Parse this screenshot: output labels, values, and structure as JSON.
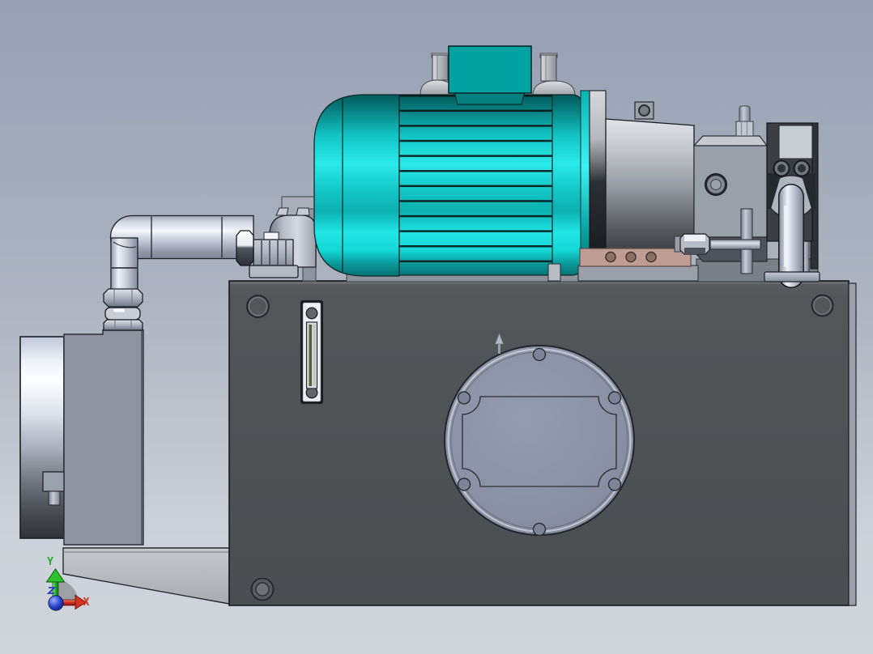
{
  "viewport": {
    "kind": "3d-cad-render",
    "subject": "hydraulic-power-unit-model",
    "triad": {
      "y_label": "Y",
      "x_label": "X",
      "y_color": "#1fae1f",
      "x_color": "#d03020",
      "z_color": "#2438c8",
      "origin_color": "#2a44cc"
    },
    "palette": {
      "background_top": "#96a0b2",
      "background_bottom": "#d0d4db",
      "motor_teal_bright": "#2beaea",
      "motor_teal_dark": "#035a5a",
      "junction_box_teal": "#00a2a2",
      "tank_gray": "#4e5255",
      "access_cover_gray": "#8b91a4",
      "pipe_silver": "#c9cdda",
      "pump_gray": "#9aa0a8",
      "pump_head_dark": "#3b3f45",
      "motor_bracket_salmon": "#bf9d94",
      "sight_glass_white": "#eef0f4",
      "sight_glass_level_olive": "#5a6038",
      "base_plate_gray": "#b9bcc1"
    },
    "parts": [
      "electric-motor",
      "motor-junction-box",
      "lifting-eyebolts",
      "bell-housing-adapter",
      "hydraulic-pump",
      "pump-head",
      "pump-breather-fitting",
      "pressure-elbow-pipe",
      "suction-elbow-pipe",
      "filler-breather-cap",
      "hex-pipe-fittings",
      "oil-tank",
      "tank-access-cover",
      "oil-level-sight-glass",
      "tank-plug-top-left",
      "tank-plug-top-right",
      "drain-plug",
      "filter-cylinder",
      "filter-mounting-plate",
      "base-plate",
      "origin-triad"
    ]
  }
}
